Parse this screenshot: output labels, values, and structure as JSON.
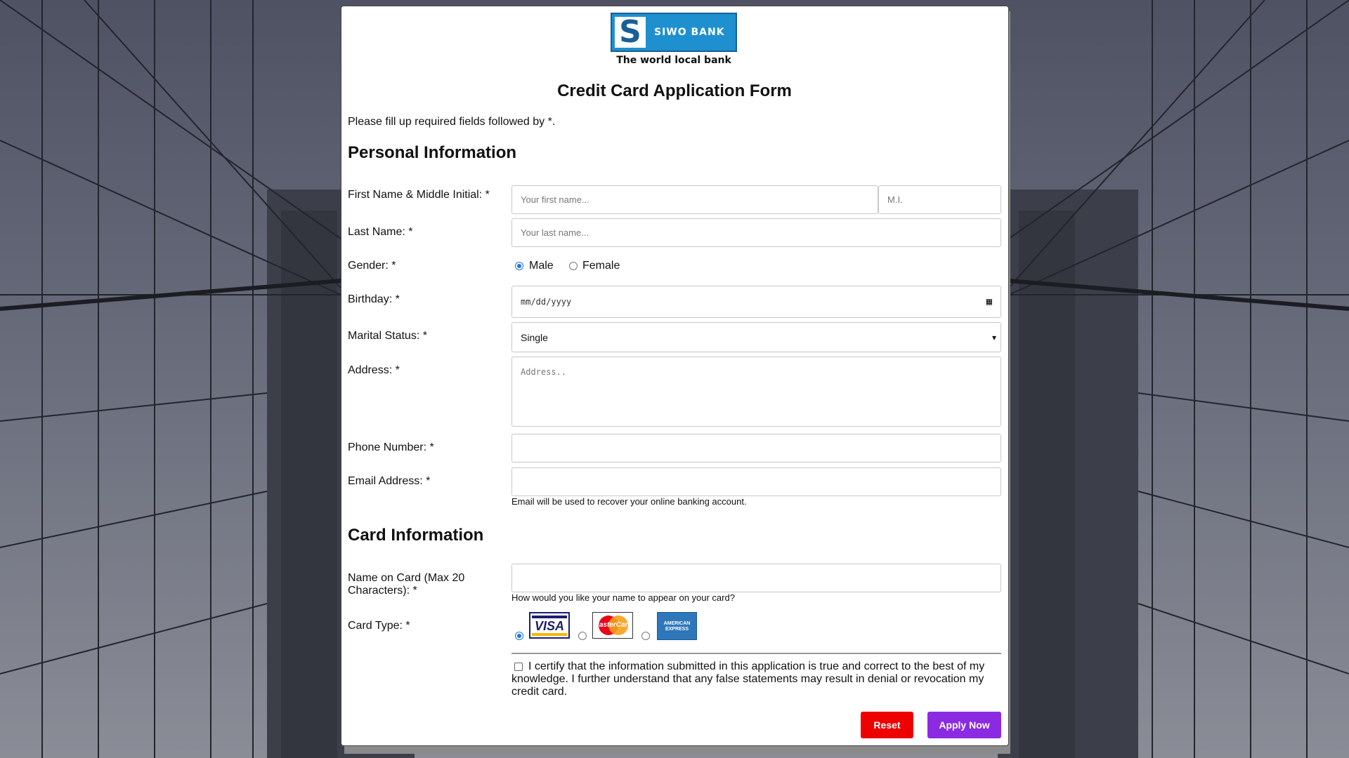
{
  "brand": {
    "name": "SIWO BANK",
    "letter": "S",
    "tagline": "The world local bank",
    "color": "#1e90d0"
  },
  "form": {
    "title": "Credit Card Application Form",
    "intro": "Please fill up required fields followed by *."
  },
  "personal": {
    "heading": "Personal Information",
    "first_name_label": "First Name & Middle Initial: *",
    "first_name_placeholder": "Your first name...",
    "mi_placeholder": "M.I.",
    "last_name_label": "Last Name: *",
    "last_name_placeholder": "Your last name...",
    "gender_label": "Gender: *",
    "gender_options": [
      "Male",
      "Female"
    ],
    "gender_selected": "Male",
    "birthday_label": "Birthday: *",
    "birthday_placeholder": "mm/dd/yyyy",
    "marital_label": "Marital Status: *",
    "marital_value": "Single",
    "address_label": "Address: *",
    "address_placeholder": "Address..",
    "phone_label": "Phone Number: *",
    "email_label": "Email Address: *",
    "email_hint": "Email will be used to recover your online banking account."
  },
  "card": {
    "heading": "Card Information",
    "name_label": "Name on Card (Max 20 Characters): *",
    "name_hint": "How would you like your name to appear on your card?",
    "type_label": "Card Type: *",
    "types": [
      "VISA",
      "MasterCard",
      "AMERICAN EXPRESS"
    ],
    "type_selected": "VISA",
    "certify_text": "I certify that the information submitted in this application is true and correct to the best of my knowledge. I further understand that any false statements may result in denial or revocation my credit card."
  },
  "buttons": {
    "reset": "Reset",
    "apply": "Apply Now",
    "reset_color": "#ee0000",
    "apply_color": "#8a2be2"
  }
}
